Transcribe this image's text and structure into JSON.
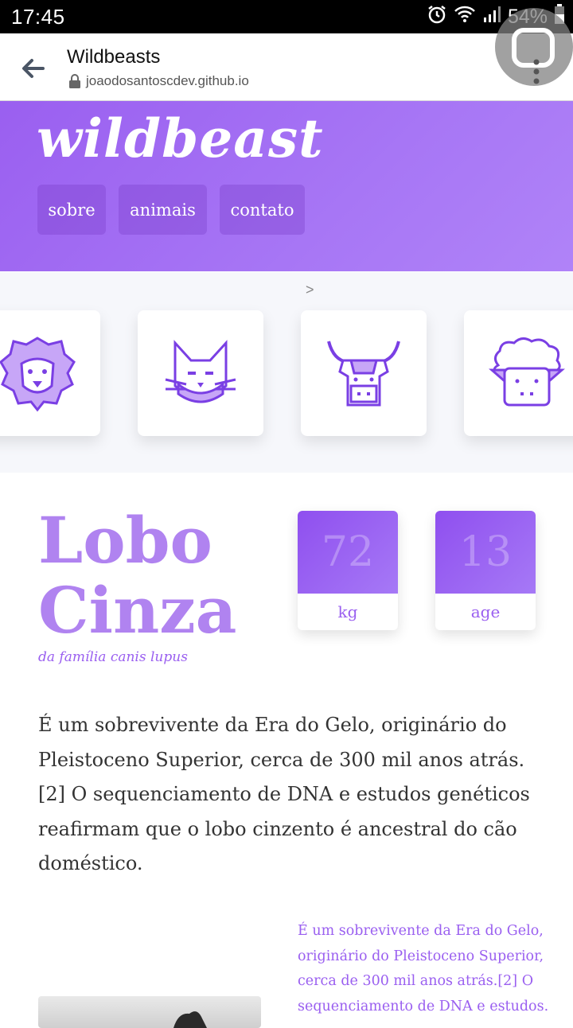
{
  "status_bar": {
    "time": "17:45",
    "battery": "54%"
  },
  "browser": {
    "title": "Wildbeasts",
    "url": "joaodosantoscdev.github.io"
  },
  "header": {
    "brand": "wildbeast",
    "nav": [
      {
        "label": "sobre"
      },
      {
        "label": "animais"
      },
      {
        "label": "contato"
      }
    ]
  },
  "carousel": {
    "arrow": ">",
    "animals": [
      {
        "icon": "lion-icon"
      },
      {
        "icon": "cat-icon"
      },
      {
        "icon": "bull-icon"
      },
      {
        "icon": "sheep-icon"
      }
    ]
  },
  "animal": {
    "name_line1": "Lobo",
    "name_line2": "Cinza",
    "family": "da família canis lupus",
    "stats": [
      {
        "value": "72",
        "unit": "kg"
      },
      {
        "value": "13",
        "unit": "age"
      }
    ],
    "description": "É um sobrevivente da Era do Gelo, originário do Pleistoceno Superior, cerca de 300 mil anos atrás.[2] O sequenciamento de DNA e estudos genéticos reafirmam que o lobo cinzento é ancestral do cão doméstico.",
    "side_text": "É um sobrevivente da Era do Gelo, originário do Pleistoceno Superior, cerca de 300 mil anos atrás.[2] O sequenciamento de DNA e estudos."
  },
  "colors": {
    "accent": "#9a5ff0",
    "accent_light": "#b083f0"
  }
}
